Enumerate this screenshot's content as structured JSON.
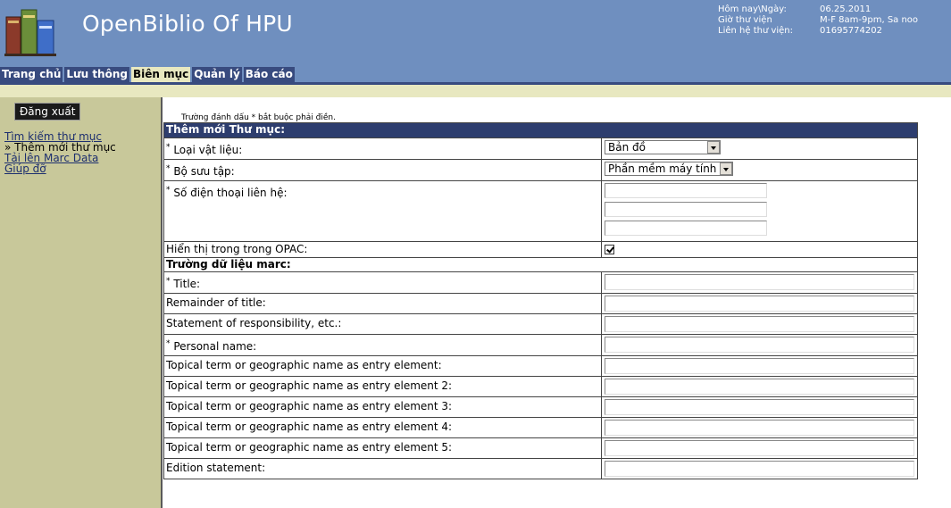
{
  "header": {
    "app_title": "OpenBiblio Of HPU",
    "date_label": "Hôm nay\\Ngày:",
    "date_value": "06.25.2011",
    "hours_label": "Giờ thư viện",
    "hours_value": "M-F 8am-9pm, Sa noo",
    "contact_label": "Liên hệ thư viện:",
    "contact_value": "01695774202"
  },
  "tabs": [
    {
      "label": "Trang chủ"
    },
    {
      "label": "Lưu thông"
    },
    {
      "label": "Biên mục"
    },
    {
      "label": "Quản lý"
    },
    {
      "label": "Báo cáo"
    }
  ],
  "sidebar": {
    "logout_label": "Đăng xuất",
    "items": [
      {
        "label": "Tìm kiếm thư mục"
      },
      {
        "label": "» Thêm mới thư mục"
      },
      {
        "label": "Tải lên Marc Data"
      },
      {
        "label": "Giúp đỡ"
      }
    ]
  },
  "form": {
    "required_note": "Trường đánh dấu * bắt buộc phải điền.",
    "header": "Thêm mới Thư mục:",
    "material_type_label": "Loại vật liệu:",
    "material_type_value": "Bản đồ",
    "collection_label": "Bộ sưu tập:",
    "collection_value": "Phần mềm máy tính",
    "call_number_label": "Số điện thoại liên hệ:",
    "opac_label": "Hiển thị trong trong OPAC:",
    "marc_section": "Trường dữ liệu marc:",
    "required_mark": "*",
    "marc_fields": [
      {
        "label": "Title:",
        "required": "*"
      },
      {
        "label": "Remainder of title:",
        "required": ""
      },
      {
        "label": "Statement of responsibility, etc.:",
        "required": ""
      },
      {
        "label": "Personal name:",
        "required": "*"
      },
      {
        "label": "Topical term or geographic name as entry element:",
        "required": ""
      },
      {
        "label": "Topical term or geographic name as entry element 2:",
        "required": ""
      },
      {
        "label": "Topical term or geographic name as entry element 3:",
        "required": ""
      },
      {
        "label": "Topical term or geographic name as entry element 4:",
        "required": ""
      },
      {
        "label": "Topical term or geographic name as entry element 5:",
        "required": ""
      },
      {
        "label": "Edition statement:",
        "required": ""
      }
    ]
  }
}
